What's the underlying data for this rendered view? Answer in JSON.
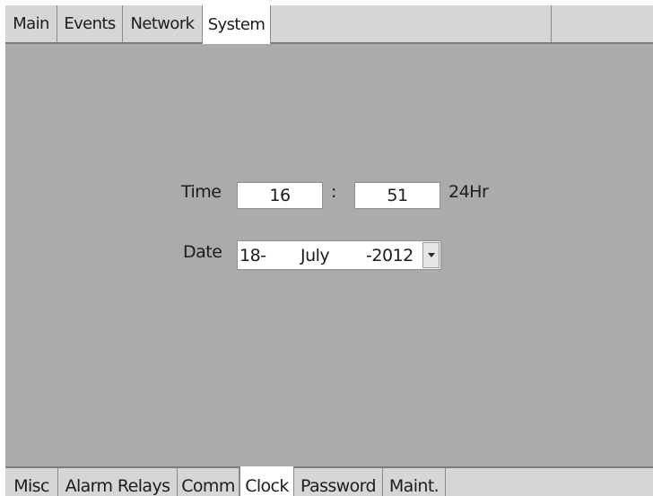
{
  "top_tabs": [
    {
      "label": "Main",
      "active": false
    },
    {
      "label": "Events",
      "active": false
    },
    {
      "label": "Network",
      "active": false
    },
    {
      "label": "System",
      "active": true
    }
  ],
  "clock": {
    "time_label": "Time",
    "hour": "16",
    "separator": ":",
    "minute": "51",
    "format": "24Hr",
    "date_label": "Date",
    "day": "18-",
    "month": "July",
    "year": "-2012"
  },
  "bottom_tabs": [
    {
      "label": "Misc",
      "active": false
    },
    {
      "label": "Alarm Relays",
      "active": false
    },
    {
      "label": "Comm",
      "active": false
    },
    {
      "label": "Clock",
      "active": true
    },
    {
      "label": "Password",
      "active": false
    },
    {
      "label": "Maint.",
      "active": false
    }
  ],
  "colors": {
    "panel_bg": "#ababab",
    "tab_bg": "#d6d6d6",
    "active_tab_bg": "#ffffff"
  }
}
